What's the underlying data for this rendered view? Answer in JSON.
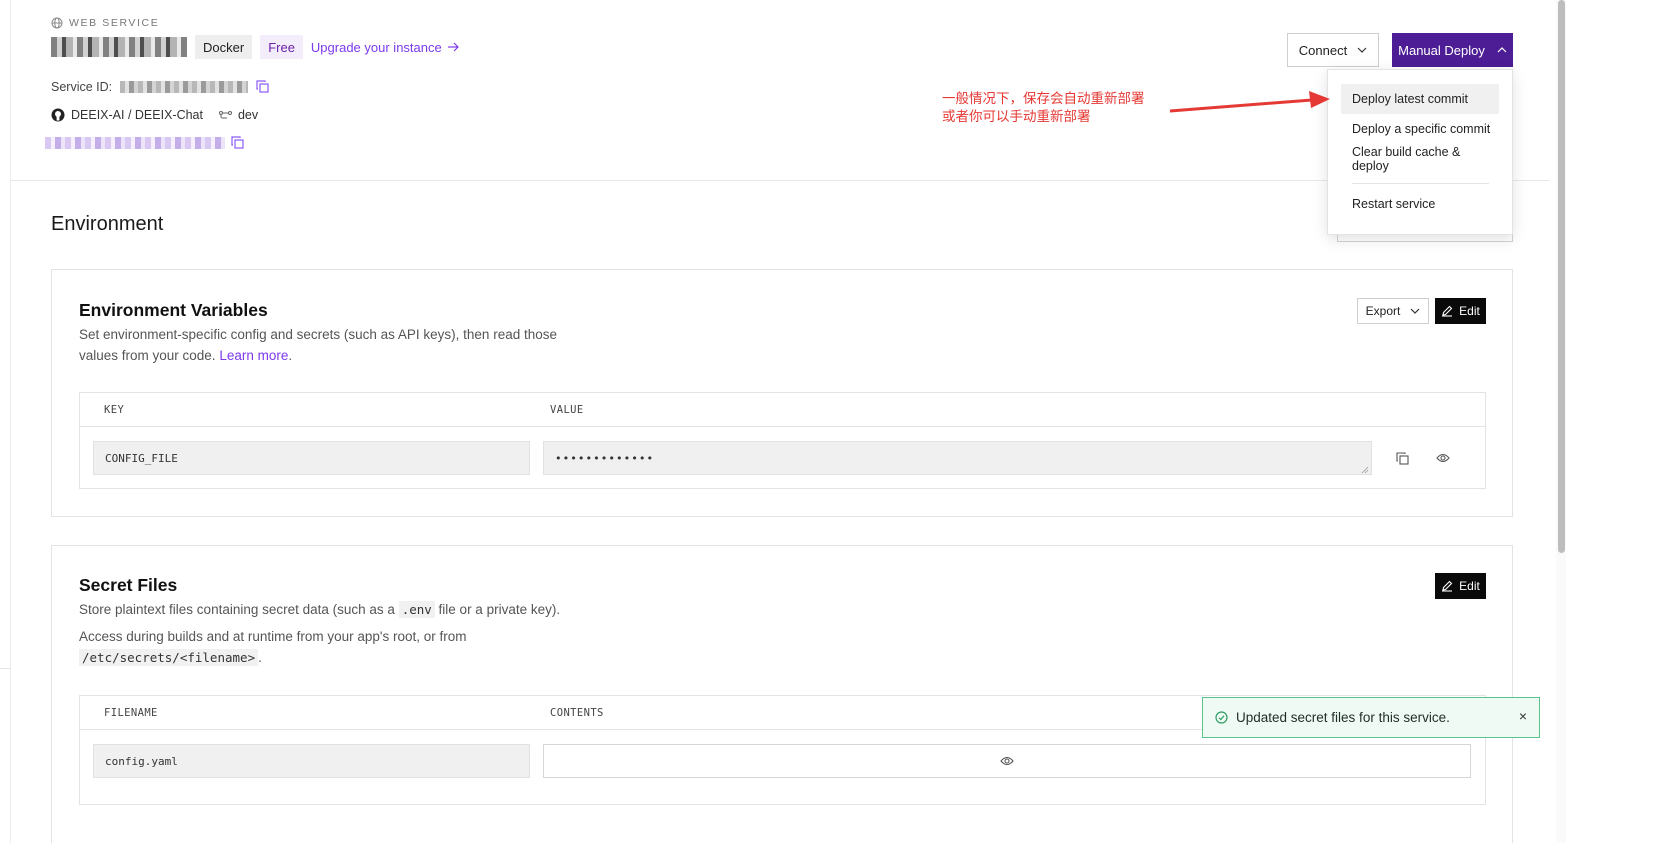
{
  "header": {
    "service_type": "WEB SERVICE",
    "badges": {
      "docker": "Docker",
      "free": "Free"
    },
    "upgrade_link": "Upgrade your instance",
    "service_id_label": "Service ID:",
    "repo": "DEEIX-AI / DEEIX-Chat",
    "branch": "dev"
  },
  "actions": {
    "connect": "Connect",
    "manual_deploy": "Manual Deploy",
    "menu": [
      "Deploy latest commit",
      "Deploy a specific commit",
      "Clear build cache & deploy",
      "Restart service"
    ]
  },
  "annotation": {
    "line1": "一般情况下，保存会自动重新部署",
    "line2": "或者你可以手动重新部署"
  },
  "section_title": "Environment",
  "env_vars": {
    "title": "Environment Variables",
    "desc_before": "Set environment-specific config and secrets (such as API keys), then read those",
    "desc_after": "values from your code.",
    "learn_more": "Learn more",
    "period": ".",
    "export": "Export",
    "edit": "Edit",
    "col_key": "KEY",
    "col_value": "VALUE",
    "rows": [
      {
        "key": "CONFIG_FILE",
        "value": "•••••••••••••"
      }
    ]
  },
  "secret_files": {
    "title": "Secret Files",
    "desc1_before": "Store plaintext files containing secret data (such as a ",
    "desc1_code": ".env",
    "desc1_after": " file or a private key).",
    "desc2": "Access during builds and at runtime from your app's root, or from",
    "desc2_code": "/etc/secrets/<filename>",
    "period": ".",
    "edit": "Edit",
    "col_filename": "FILENAME",
    "col_contents": "CONTENTS",
    "rows": [
      {
        "filename": "config.yaml"
      }
    ]
  },
  "toast": {
    "message": "Updated secret files for this service.",
    "close": "×"
  },
  "colors": {
    "accent": "#4c1d95",
    "link": "#7c3aed",
    "annotation": "#e53935",
    "toast_border": "#5cc28c"
  }
}
